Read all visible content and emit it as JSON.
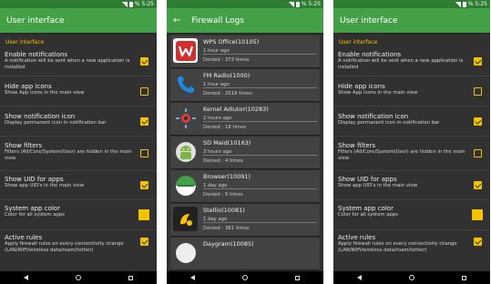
{
  "status": {
    "battery": "% 5:25"
  },
  "settings": {
    "title": "User interface",
    "section": "User interface",
    "items": [
      {
        "title": "Enable notifications",
        "summary": "A notification will be sent when a new application is installed",
        "control": "checkbox",
        "checked": true
      },
      {
        "title": "Hide app icons",
        "summary": "Show App icons in the main view",
        "control": "checkbox",
        "checked": false
      },
      {
        "title": "Show notification icon",
        "summary": "Display permanent icon in notification bar",
        "control": "checkbox",
        "checked": true
      },
      {
        "title": "Show filters",
        "summary": "Filters (All/Core/System/User) are hidden in the main view",
        "control": "checkbox",
        "checked": false
      },
      {
        "title": "Show UID for apps",
        "summary": "Show app UID's in the main view",
        "control": "checkbox",
        "checked": true
      },
      {
        "title": "System app color",
        "summary": "Color for all system apps",
        "control": "swatch",
        "color": "#f4c300"
      },
      {
        "title": "Active rules",
        "summary": "Apply firewall rules on every connectivity change (LAN/WiFi/wireless data/roam/tether)",
        "control": "checkbox",
        "checked": true
      }
    ]
  },
  "logs": {
    "title": "Firewall Logs",
    "entries": [
      {
        "name": "WPS Office(10105)",
        "ago": "1 hour ago",
        "denied": "Denied : 373 times",
        "icon": "wps-office-icon"
      },
      {
        "name": "FM Radio(1000)",
        "ago": "1 hour ago",
        "denied": "Denied : 2518 times",
        "icon": "phone-icon"
      },
      {
        "name": "Kernel Adiutor(10283)",
        "ago": "2 hours ago",
        "denied": "Denied : 18 times",
        "icon": "kernel-adiutor-icon"
      },
      {
        "name": "SD Maid(10163)",
        "ago": "3 hours ago",
        "denied": "Denied : 4 times",
        "icon": "sd-maid-icon"
      },
      {
        "name": "Browser(10091)",
        "ago": "1 day ago",
        "denied": "Denied : 5 times",
        "icon": "browser-icon"
      },
      {
        "name": "Stellio(10081)",
        "ago": "1 day ago",
        "denied": "Denied : 361 times",
        "icon": "stellio-icon"
      },
      {
        "name": "Daygram(10085)",
        "ago": "",
        "denied": "",
        "icon": "daygram-icon"
      }
    ]
  },
  "colors": {
    "primary": "#43a047",
    "statusbar": "#2e7d32",
    "accent": "#f4c300",
    "background": "#313131"
  }
}
